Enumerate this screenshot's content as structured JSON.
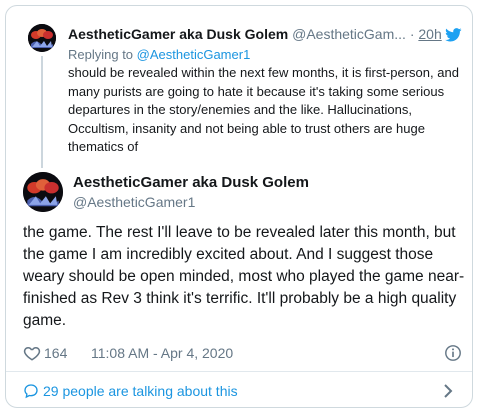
{
  "parent_tweet": {
    "display_name": "AestheticGamer aka Dusk Golem",
    "handle": "@AestheticGam...",
    "separator": "·",
    "time": "20h",
    "replying_prefix": "Replying to",
    "replying_to": "@AestheticGamer1",
    "text": "should be revealed within the next few months, it is first-person, and many purists are going to hate it because it's taking some serious departures in the story/enemies and the like. Hallucinations, Occultism, insanity and  not being able to trust others are huge thematics of"
  },
  "main_tweet": {
    "display_name": "AestheticGamer aka Dusk Golem",
    "handle": "@AestheticGamer1",
    "text": "the game. The rest I'll leave to be revealed later this month, but the game I am incredibly excited about. And I suggest those weary should be open minded, most who played the game near-finished as Rev 3 think it's terrific. It'll probably be a high quality game.",
    "likes": "164",
    "timestamp": "11:08 AM - Apr 4, 2020"
  },
  "footer": {
    "talking_text": "29 people are talking about this"
  },
  "colors": {
    "link_blue": "#1b95e0",
    "muted_gray": "#657786",
    "text_dark": "#14171a",
    "border": "#cfd9de"
  },
  "icons": [
    "avatar",
    "twitter-bird-icon",
    "heart-icon",
    "info-icon",
    "speech-bubble-icon",
    "chevron-right-icon"
  ]
}
